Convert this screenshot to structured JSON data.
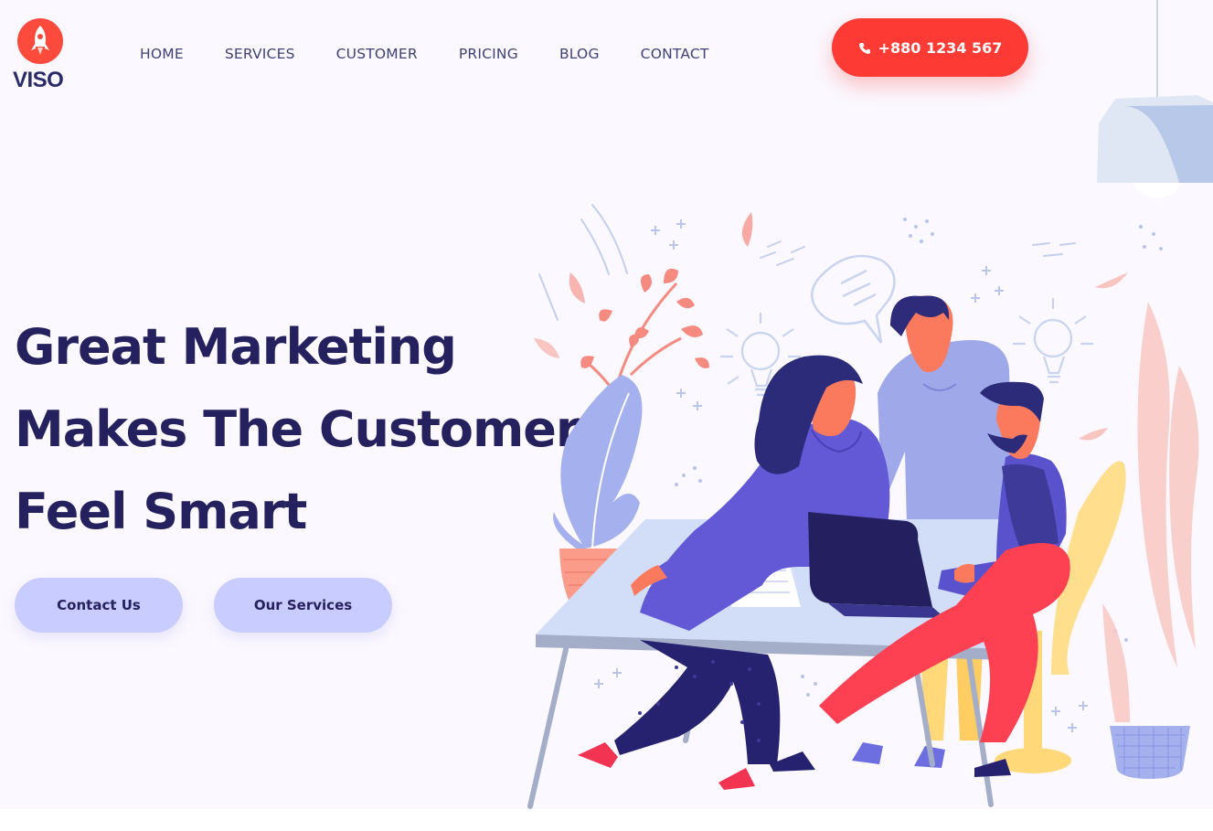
{
  "brand": {
    "name": "VISO",
    "logo_icon": "rocket-icon",
    "accent_color": "#fc4a3c"
  },
  "nav": {
    "items": [
      {
        "label": "HOME"
      },
      {
        "label": "SERVICES"
      },
      {
        "label": "CUSTOMER"
      },
      {
        "label": "PRICING"
      },
      {
        "label": "BLOG"
      },
      {
        "label": "CONTACT"
      }
    ]
  },
  "header": {
    "phone": "+880 1234 567",
    "phone_icon": "phone-icon",
    "phone_button_color": "#fd3a34"
  },
  "hero": {
    "headline_lines": [
      "Great Marketing",
      "Makes The Customer",
      "Feel Smart"
    ],
    "buttons": {
      "contact_label": "Contact Us",
      "services_label": "Our Services"
    },
    "button_color": "#c9ccff",
    "illustration": "team-working-at-desk-illustration"
  }
}
